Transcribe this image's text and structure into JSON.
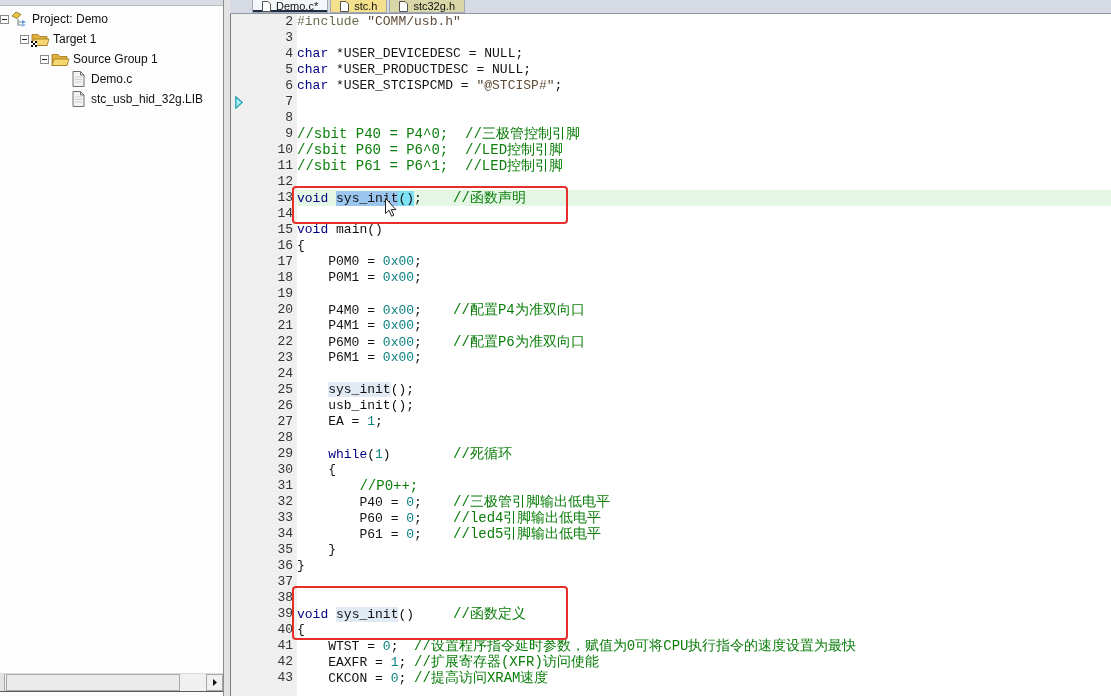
{
  "project_tree": [
    {
      "label": "Project: Demo",
      "kind": "project",
      "expanded": true,
      "children": [
        {
          "label": "Target 1",
          "kind": "target",
          "expanded": true,
          "children": [
            {
              "label": "Source Group 1",
              "kind": "group",
              "expanded": true,
              "children": [
                {
                  "label": "Demo.c",
                  "kind": "file"
                },
                {
                  "label": "stc_usb_hid_32g.LIB",
                  "kind": "file"
                }
              ]
            }
          ]
        }
      ]
    }
  ],
  "tabs": [
    {
      "label": "Demo.c*",
      "selected": true
    },
    {
      "label": "stc.h",
      "selected": false,
      "color": "#f4e08c"
    },
    {
      "label": "stc32g.h",
      "selected": false,
      "color": "#d9d7a8"
    }
  ],
  "editor": {
    "lines": [
      {
        "number": "2",
        "current": false,
        "marker": false,
        "boxed": false,
        "tokens": [
          {
            "kind": "preprocessor",
            "text": "#include "
          },
          {
            "kind": "string",
            "text": "\"COMM/usb.h\""
          }
        ]
      },
      {
        "number": "3",
        "current": false,
        "marker": false,
        "boxed": false
      },
      {
        "number": "4",
        "current": false,
        "marker": false,
        "boxed": false,
        "tokens": [
          {
            "kind": "keyword",
            "text": "char"
          },
          {
            "kind": "plain",
            "text": " *USER_DEVICEDESC = NULL;"
          }
        ]
      },
      {
        "number": "5",
        "current": false,
        "marker": false,
        "boxed": false,
        "tokens": [
          {
            "kind": "keyword",
            "text": "char"
          },
          {
            "kind": "plain",
            "text": " *USER_PRODUCTDESC = NULL;"
          }
        ]
      },
      {
        "number": "6",
        "current": false,
        "marker": false,
        "boxed": false,
        "tokens": [
          {
            "kind": "keyword",
            "text": "char"
          },
          {
            "kind": "plain",
            "text": " *USER_STCISPCMD = "
          },
          {
            "kind": "string",
            "text": "\"@STCISP#\""
          },
          {
            "kind": "plain",
            "text": ";"
          }
        ]
      },
      {
        "number": "7",
        "current": false,
        "marker": true,
        "boxed": false
      },
      {
        "number": "8",
        "current": false,
        "marker": false,
        "boxed": false
      },
      {
        "number": "9",
        "current": false,
        "marker": false,
        "boxed": false,
        "tokens": [
          {
            "kind": "comment",
            "text": "//sbit P40 = P4^0;  //三极管控制引脚"
          }
        ]
      },
      {
        "number": "10",
        "current": false,
        "marker": false,
        "boxed": false,
        "tokens": [
          {
            "kind": "comment",
            "text": "//sbit P60 = P6^0;  //LED控制引脚"
          }
        ]
      },
      {
        "number": "11",
        "current": false,
        "marker": false,
        "boxed": false,
        "tokens": [
          {
            "kind": "comment",
            "text": "//sbit P61 = P6^1;  //LED控制引脚"
          }
        ]
      },
      {
        "number": "12",
        "current": false,
        "marker": false,
        "boxed": false
      },
      {
        "number": "13",
        "current": true,
        "marker": false,
        "boxed": true,
        "tokens": [
          {
            "kind": "keyword",
            "text": "void"
          },
          {
            "kind": "selection",
            "text": " sys_init"
          },
          {
            "kind": "brace",
            "text": "()"
          },
          {
            "kind": "plain",
            "text": ";"
          },
          {
            "kind": "comment",
            "text": "    //函数声明"
          }
        ]
      },
      {
        "number": "14",
        "current": false,
        "marker": false,
        "boxed": true
      },
      {
        "number": "15",
        "current": false,
        "marker": false,
        "boxed": false,
        "tokens": [
          {
            "kind": "keyword",
            "text": "void"
          },
          {
            "kind": "plain",
            "text": " main()"
          }
        ]
      },
      {
        "number": "16",
        "current": false,
        "marker": false,
        "boxed": false,
        "tokens": [
          {
            "kind": "plain",
            "text": "{"
          }
        ]
      },
      {
        "number": "17",
        "current": false,
        "marker": false,
        "boxed": false,
        "tokens": [
          {
            "kind": "plain",
            "text": "    P0M0 = "
          },
          {
            "kind": "number",
            "text": "0x00"
          },
          {
            "kind": "plain",
            "text": ";"
          }
        ]
      },
      {
        "number": "18",
        "current": false,
        "marker": false,
        "boxed": false,
        "tokens": [
          {
            "kind": "plain",
            "text": "    P0M1 = "
          },
          {
            "kind": "number",
            "text": "0x00"
          },
          {
            "kind": "plain",
            "text": ";"
          }
        ]
      },
      {
        "number": "19",
        "current": false,
        "marker": false,
        "boxed": false
      },
      {
        "number": "20",
        "current": false,
        "marker": false,
        "boxed": false,
        "tokens": [
          {
            "kind": "plain",
            "text": "    P4M0 = "
          },
          {
            "kind": "number",
            "text": "0x00"
          },
          {
            "kind": "plain",
            "text": ";"
          },
          {
            "kind": "comment",
            "text": "    //配置P4为准双向口"
          }
        ]
      },
      {
        "number": "21",
        "current": false,
        "marker": false,
        "boxed": false,
        "tokens": [
          {
            "kind": "plain",
            "text": "    P4M1 = "
          },
          {
            "kind": "number",
            "text": "0x00"
          },
          {
            "kind": "plain",
            "text": ";"
          }
        ]
      },
      {
        "number": "22",
        "current": false,
        "marker": false,
        "boxed": false,
        "tokens": [
          {
            "kind": "plain",
            "text": "    P6M0 = "
          },
          {
            "kind": "number",
            "text": "0x00"
          },
          {
            "kind": "plain",
            "text": ";"
          },
          {
            "kind": "comment",
            "text": "    //配置P6为准双向口"
          }
        ]
      },
      {
        "number": "23",
        "current": false,
        "marker": false,
        "boxed": false,
        "tokens": [
          {
            "kind": "plain",
            "text": "    P6M1 = "
          },
          {
            "kind": "number",
            "text": "0x00"
          },
          {
            "kind": "plain",
            "text": ";"
          }
        ]
      },
      {
        "number": "24",
        "current": false,
        "marker": false,
        "boxed": false
      },
      {
        "number": "25",
        "current": false,
        "marker": false,
        "boxed": false,
        "tokens": [
          {
            "kind": "occurrence",
            "text": "    sys_init"
          },
          {
            "kind": "plain",
            "text": "();"
          }
        ]
      },
      {
        "number": "26",
        "current": false,
        "marker": false,
        "boxed": false,
        "tokens": [
          {
            "kind": "plain",
            "text": "    usb_init();"
          }
        ]
      },
      {
        "number": "27",
        "current": false,
        "marker": false,
        "boxed": false,
        "tokens": [
          {
            "kind": "plain",
            "text": "    EA = "
          },
          {
            "kind": "number",
            "text": "1"
          },
          {
            "kind": "plain",
            "text": ";"
          }
        ]
      },
      {
        "number": "28",
        "current": false,
        "marker": false,
        "boxed": false
      },
      {
        "number": "29",
        "current": false,
        "marker": false,
        "boxed": false,
        "tokens": [
          {
            "kind": "keyword",
            "text": "    while"
          },
          {
            "kind": "plain",
            "text": "("
          },
          {
            "kind": "number",
            "text": "1"
          },
          {
            "kind": "plain",
            "text": ")"
          },
          {
            "kind": "comment",
            "text": "        //死循环"
          }
        ]
      },
      {
        "number": "30",
        "current": false,
        "marker": false,
        "boxed": false,
        "tokens": [
          {
            "kind": "plain",
            "text": "    {"
          }
        ]
      },
      {
        "number": "31",
        "current": false,
        "marker": false,
        "boxed": false,
        "tokens": [
          {
            "kind": "comment",
            "text": "        //P0++;"
          }
        ]
      },
      {
        "number": "32",
        "current": false,
        "marker": false,
        "boxed": false,
        "tokens": [
          {
            "kind": "plain",
            "text": "        P40 = "
          },
          {
            "kind": "number",
            "text": "0"
          },
          {
            "kind": "plain",
            "text": ";"
          },
          {
            "kind": "comment",
            "text": "    //三极管引脚输出低电平"
          }
        ]
      },
      {
        "number": "33",
        "current": false,
        "marker": false,
        "boxed": false,
        "tokens": [
          {
            "kind": "plain",
            "text": "        P60 = "
          },
          {
            "kind": "number",
            "text": "0"
          },
          {
            "kind": "plain",
            "text": ";"
          },
          {
            "kind": "comment",
            "text": "    //led4引脚输出低电平"
          }
        ]
      },
      {
        "number": "34",
        "current": false,
        "marker": false,
        "boxed": false,
        "tokens": [
          {
            "kind": "plain",
            "text": "        P61 = "
          },
          {
            "kind": "number",
            "text": "0"
          },
          {
            "kind": "plain",
            "text": ";"
          },
          {
            "kind": "comment",
            "text": "    //led5引脚输出低电平"
          }
        ]
      },
      {
        "number": "35",
        "current": false,
        "marker": false,
        "boxed": false,
        "tokens": [
          {
            "kind": "plain",
            "text": "    }"
          }
        ]
      },
      {
        "number": "36",
        "current": false,
        "marker": false,
        "boxed": false,
        "tokens": [
          {
            "kind": "plain",
            "text": "}"
          }
        ]
      },
      {
        "number": "37",
        "current": false,
        "marker": false,
        "boxed": false
      },
      {
        "number": "38",
        "current": false,
        "marker": false,
        "boxed": true
      },
      {
        "number": "39",
        "current": false,
        "marker": false,
        "boxed": true,
        "tokens": [
          {
            "kind": "keyword",
            "text": "void"
          },
          {
            "kind": "occurrence",
            "text": " sys_init"
          },
          {
            "kind": "plain",
            "text": "()"
          },
          {
            "kind": "comment",
            "text": "     //函数定义"
          }
        ]
      },
      {
        "number": "40",
        "current": false,
        "marker": false,
        "boxed": true,
        "tokens": [
          {
            "kind": "plain",
            "text": "{"
          }
        ]
      },
      {
        "number": "41",
        "current": false,
        "marker": false,
        "boxed": false,
        "tokens": [
          {
            "kind": "plain",
            "text": "    WTST = "
          },
          {
            "kind": "number",
            "text": "0"
          },
          {
            "kind": "plain",
            "text": ";"
          },
          {
            "kind": "comment",
            "text": "  //设置程序指令延时参数，赋值为0可将CPU执行指令的速度设置为最快"
          }
        ]
      },
      {
        "number": "42",
        "current": false,
        "marker": false,
        "boxed": false,
        "tokens": [
          {
            "kind": "plain",
            "text": "    EAXFR = "
          },
          {
            "kind": "number",
            "text": "1"
          },
          {
            "kind": "plain",
            "text": ";"
          },
          {
            "kind": "comment",
            "text": " //扩展寄存器(XFR)访问使能"
          }
        ]
      },
      {
        "number": "43",
        "current": false,
        "marker": false,
        "boxed": false,
        "tokens": [
          {
            "kind": "plain",
            "text": "    CKCON = "
          },
          {
            "kind": "number",
            "text": "0"
          },
          {
            "kind": "plain",
            "text": ";"
          },
          {
            "kind": "comment",
            "text": " //提高访问XRAM速度"
          }
        ]
      }
    ]
  }
}
